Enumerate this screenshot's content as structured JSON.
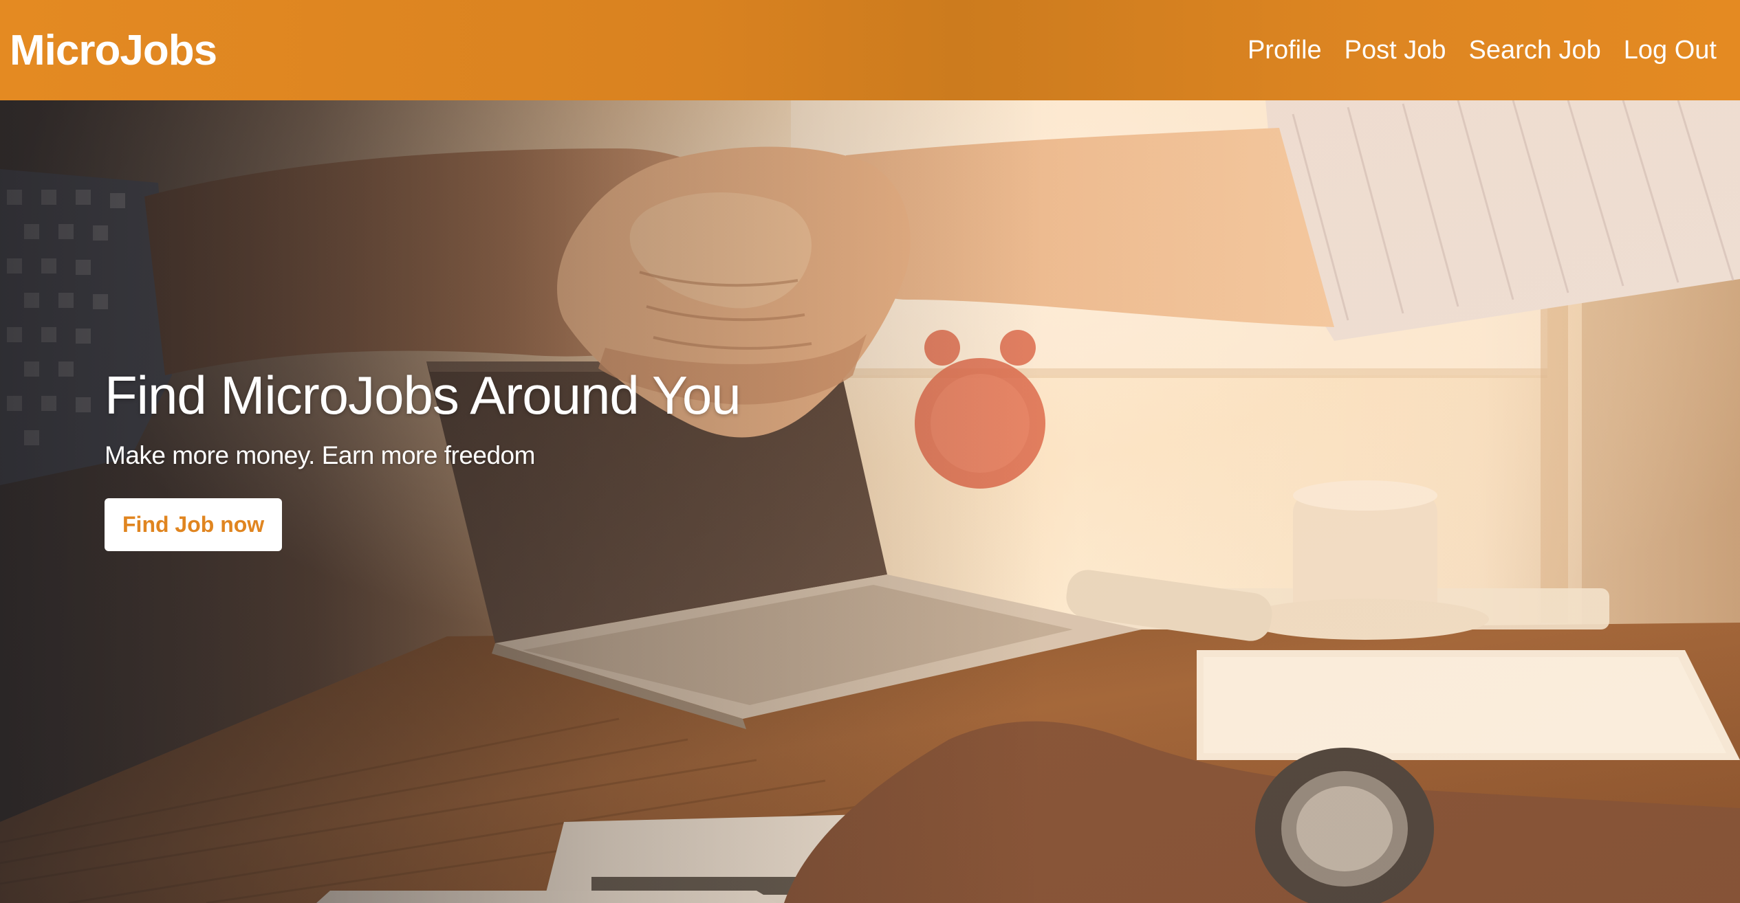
{
  "navbar": {
    "brand": "MicroJobs",
    "links": [
      {
        "label": "Profile"
      },
      {
        "label": "Post Job"
      },
      {
        "label": "Search Job"
      },
      {
        "label": "Log Out"
      }
    ]
  },
  "hero": {
    "title": "Find MicroJobs Around You",
    "subtitle": "Make more money. Earn more freedom",
    "cta_label": "Find Job now",
    "background_image": "handshake-over-desk-photo"
  },
  "colors": {
    "brand_orange": "#e48a22",
    "button_text": "#e08520",
    "white": "#ffffff"
  }
}
